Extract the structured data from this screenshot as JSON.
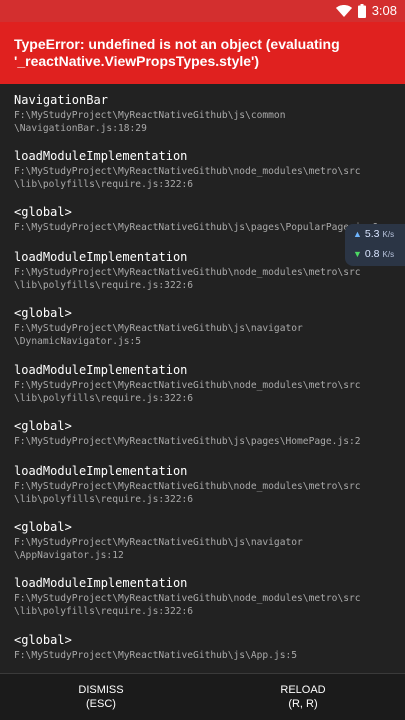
{
  "status_bar": {
    "time": "3:08",
    "wifi_icon": "wifi-icon",
    "battery_icon": "battery-icon"
  },
  "error": {
    "message": "TypeError: undefined is not an object (evaluating '_reactNative.ViewPropsTypes.style')",
    "background": "#e0211f"
  },
  "stack": [
    {
      "method": "NavigationBar",
      "location": "F:\\MyStudyProject\\MyReactNativeGithub\\js\\common\n\\NavigationBar.js:18:29"
    },
    {
      "method": "loadModuleImplementation",
      "location": "F:\\MyStudyProject\\MyReactNativeGithub\\node_modules\\metro\\src\n\\lib\\polyfills\\require.js:322:6"
    },
    {
      "method": "<global>",
      "location": "F:\\MyStudyProject\\MyReactNativeGithub\\js\\pages\\PopularPage.js:6"
    },
    {
      "method": "loadModuleImplementation",
      "location": "F:\\MyStudyProject\\MyReactNativeGithub\\node_modules\\metro\\src\n\\lib\\polyfills\\require.js:322:6"
    },
    {
      "method": "<global>",
      "location": "F:\\MyStudyProject\\MyReactNativeGithub\\js\\navigator\n\\DynamicNavigator.js:5"
    },
    {
      "method": "loadModuleImplementation",
      "location": "F:\\MyStudyProject\\MyReactNativeGithub\\node_modules\\metro\\src\n\\lib\\polyfills\\require.js:322:6"
    },
    {
      "method": "<global>",
      "location": "F:\\MyStudyProject\\MyReactNativeGithub\\js\\pages\\HomePage.js:2"
    },
    {
      "method": "loadModuleImplementation",
      "location": "F:\\MyStudyProject\\MyReactNativeGithub\\node_modules\\metro\\src\n\\lib\\polyfills\\require.js:322:6"
    },
    {
      "method": "<global>",
      "location": "F:\\MyStudyProject\\MyReactNativeGithub\\js\\navigator\n\\AppNavigator.js:12"
    },
    {
      "method": "loadModuleImplementation",
      "location": "F:\\MyStudyProject\\MyReactNativeGithub\\node_modules\\metro\\src\n\\lib\\polyfills\\require.js:322:6"
    },
    {
      "method": "<global>",
      "location": "F:\\MyStudyProject\\MyReactNativeGithub\\js\\App.js:5"
    }
  ],
  "net_speed": {
    "up_value": "5.3",
    "up_unit": "K/s",
    "down_value": "0.8",
    "down_unit": "K/s"
  },
  "footer": {
    "dismiss_label": "DISMISS",
    "dismiss_shortcut": "(ESC)",
    "reload_label": "RELOAD",
    "reload_shortcut": "(R, R)"
  }
}
